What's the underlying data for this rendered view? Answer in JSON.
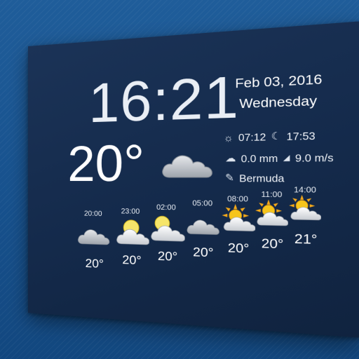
{
  "clock": {
    "time": "16:21",
    "current_temp": "20°"
  },
  "date_block": {
    "date": "Feb 03, 2016",
    "weekday": "Wednesday"
  },
  "details": {
    "sunrise": "07:12",
    "sunset": "17:53",
    "precipitation": "0.0 mm",
    "wind": "9.0 m/s",
    "location": "Bermuda"
  },
  "current_icon": "cloud-icon",
  "forecast": [
    {
      "time": "20:00",
      "temp": "20°",
      "icon": "cloud-icon"
    },
    {
      "time": "23:00",
      "temp": "20°",
      "icon": "moon-cloud-icon"
    },
    {
      "time": "02:00",
      "temp": "20°",
      "icon": "moon-cloud-icon"
    },
    {
      "time": "05:00",
      "temp": "20°",
      "icon": "cloud-icon"
    },
    {
      "time": "08:00",
      "temp": "20°",
      "icon": "sun-cloud-icon"
    },
    {
      "time": "11:00",
      "temp": "20°",
      "icon": "sun-cloud-icon"
    },
    {
      "time": "14:00",
      "temp": "21°",
      "icon": "sun-cloud-icon"
    }
  ],
  "colors": {
    "background": "#17518d",
    "widget": "#142a4b",
    "text": "#ffffff",
    "cloud": "#bfc4cb",
    "sun": "#f4c21a",
    "moon": "#f6e56a"
  }
}
